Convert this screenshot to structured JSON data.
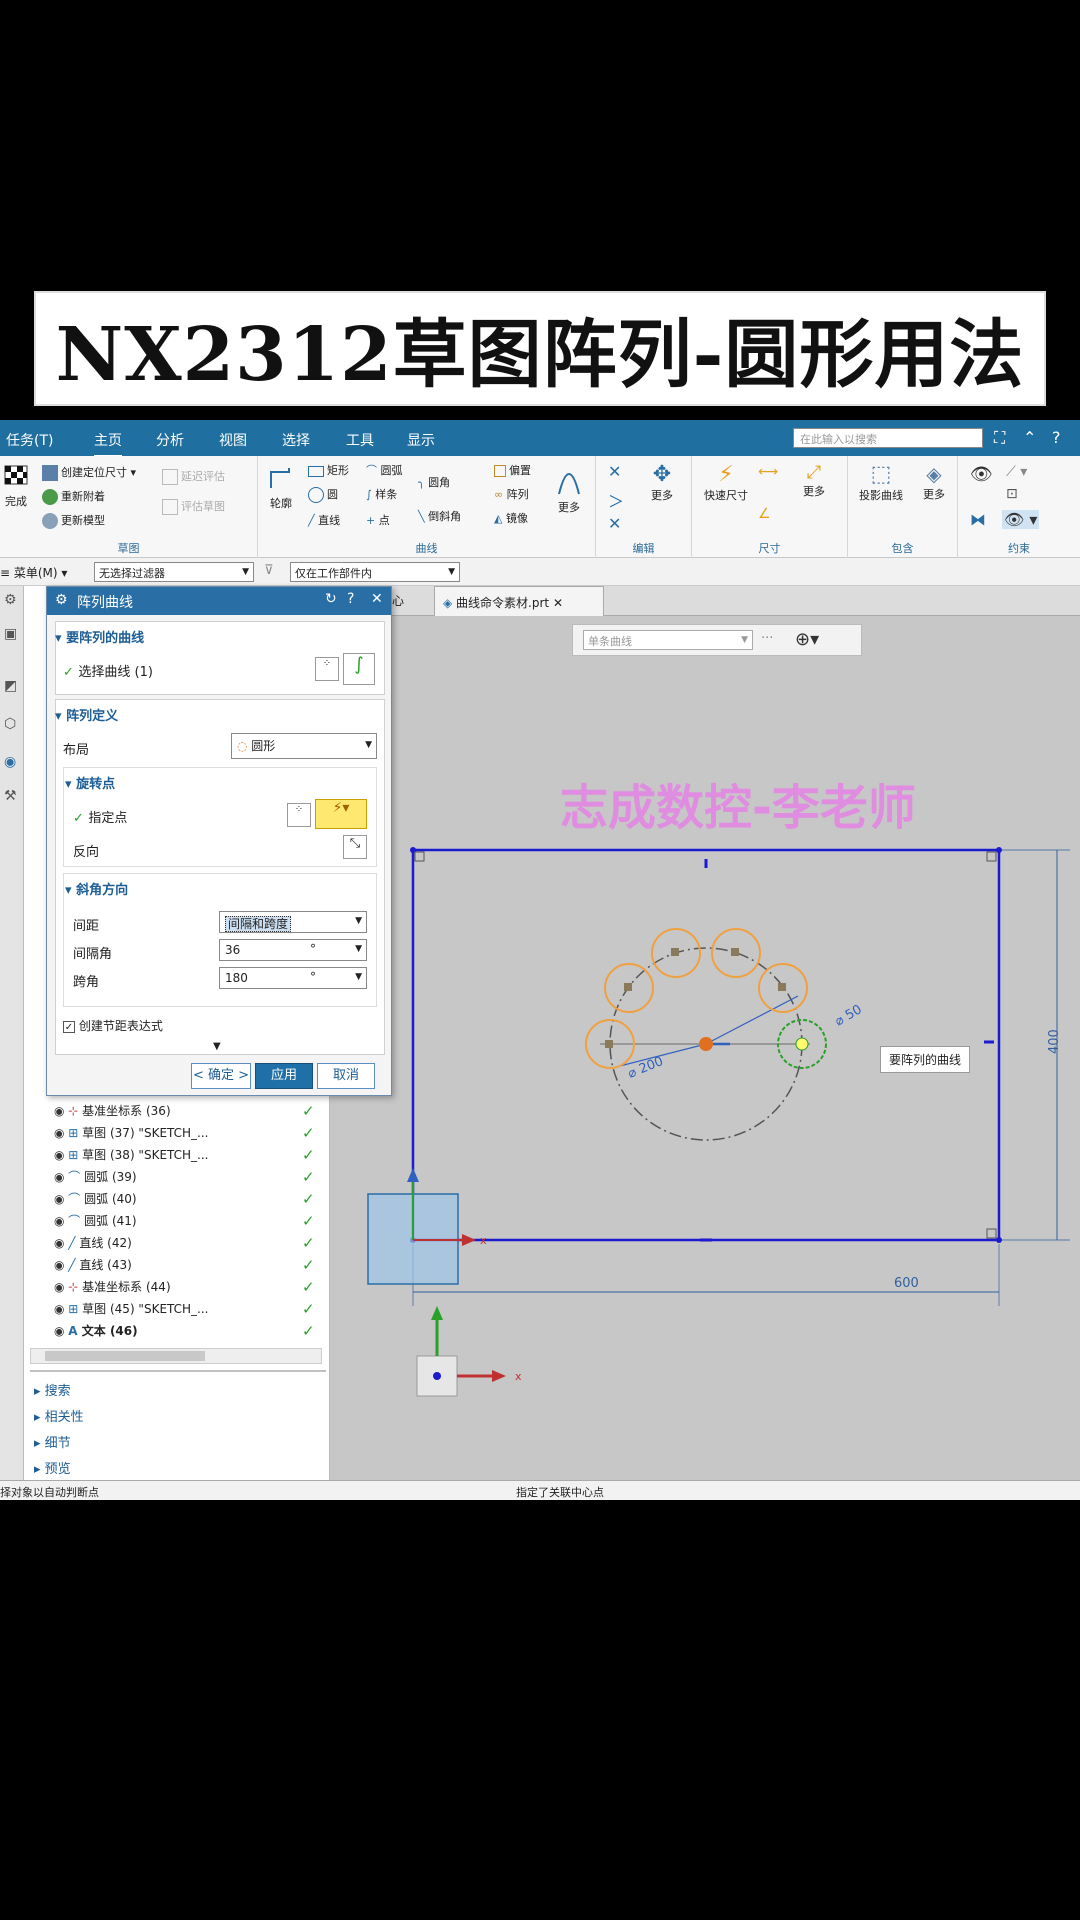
{
  "banner": {
    "title": "NX2312草图阵列-圆形用法"
  },
  "menubar": {
    "tabs": [
      "任务(T)",
      "主页",
      "分析",
      "视图",
      "选择",
      "工具",
      "显示"
    ],
    "active_tab": "主页",
    "search_placeholder": "在此输入以搜索"
  },
  "ribbon": {
    "finish": "完成",
    "create_dim": "创建定位尺寸",
    "reattach": "重新附着",
    "update_model": "更新模型",
    "delay_eval": "延迟评估",
    "eval_sketch": "评估草图",
    "group_sketch": "草图",
    "profile": "轮廓",
    "rectangle": "矩形",
    "arc": "圆弧",
    "circle": "圆",
    "spline": "样条",
    "line": "直线",
    "point": "点",
    "fillet": "圆角",
    "chamfer": "倒斜角",
    "offset": "偏置",
    "pattern": "阵列",
    "mirror": "镜像",
    "more": "更多",
    "group_curve": "曲线",
    "group_edit": "编辑",
    "quick_dim": "快速尺寸",
    "group_dim": "尺寸",
    "project_curve": "投影曲线",
    "group_include": "包含",
    "group_constraint": "约束"
  },
  "filterbar": {
    "menu": "菜单(M)",
    "filter": "无选择过滤器",
    "scope": "仅在工作部件内"
  },
  "doctabs": {
    "tab1": "心",
    "tab2": "曲线命令素材.prt"
  },
  "dialog": {
    "title": "阵列曲线",
    "sec_curves": "要阵列的曲线",
    "select_curve": "选择曲线 (1)",
    "sec_def": "阵列定义",
    "layout_label": "布局",
    "layout_value": "圆形",
    "sec_rotation": "旋转点",
    "specify_point": "指定点",
    "reverse": "反向",
    "sec_angle": "斜角方向",
    "spacing_label": "间距",
    "spacing_value": "间隔和跨度",
    "pitch_label": "间隔角",
    "pitch_value": "36",
    "span_label": "跨角",
    "span_value": "180",
    "deg": "°",
    "create_expr": "创建节距表达式",
    "ok": "< 确定 >",
    "apply": "应用",
    "cancel": "取消"
  },
  "tree": {
    "items": [
      {
        "label": "基准坐标系 (36)"
      },
      {
        "label": "草图 (37) \"SKETCH_..."
      },
      {
        "label": "草图 (38) \"SKETCH_..."
      },
      {
        "label": "圆弧 (39)"
      },
      {
        "label": "圆弧 (40)"
      },
      {
        "label": "圆弧 (41)"
      },
      {
        "label": "直线 (42)"
      },
      {
        "label": "直线 (43)"
      },
      {
        "label": "基准坐标系 (44)"
      },
      {
        "label": "草图 (45) \"SKETCH_..."
      },
      {
        "label": "文本 (46)"
      }
    ]
  },
  "accordion": [
    "搜索",
    "相关性",
    "细节",
    "预览"
  ],
  "canvas": {
    "watermark": "志成数控-李老师",
    "dim_width": "600",
    "dim_height": "400",
    "dim_dia200": "⌀ 200",
    "dim_dia50": "⌀ 50",
    "tooltip": "要阵列的曲线",
    "curve_filter": "单条曲线",
    "axis_x": "x"
  },
  "status": {
    "left": "择对象以自动判断点",
    "center": "指定了关联中心点"
  }
}
